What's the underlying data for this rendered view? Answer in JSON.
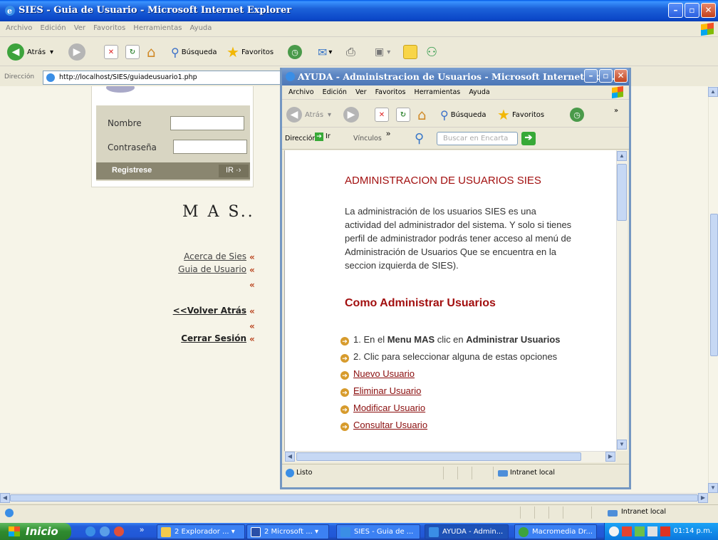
{
  "main_window": {
    "title": "SIES - Guia de Usuario - Microsoft Internet Explorer",
    "menu": [
      "Archivo",
      "Edición",
      "Ver",
      "Favoritos",
      "Herramientas",
      "Ayuda"
    ],
    "toolbar": {
      "back": "Atrás",
      "search": "Búsqueda",
      "favorites": "Favoritos"
    },
    "address_label": "Dirección",
    "address_url": "http://localhost/SIES/guiadeusuario1.php",
    "status_zone": "Intranet local"
  },
  "page": {
    "login": {
      "nombre_label": "Nombre",
      "pass_label": "Contraseña",
      "register": "Registrese",
      "go": "IR"
    },
    "mas_title": "M A S..",
    "links": {
      "acerca": "Acerca de Sies",
      "guia": "Guia de Usuario",
      "volver": "<<Volver Atrás",
      "cerrar": "Cerrar Sesión"
    },
    "raquo": "«"
  },
  "popup": {
    "title": "AYUDA - Administracion de Usuarios - Microsoft Internet Expl...",
    "menu": [
      "Archivo",
      "Edición",
      "Ver",
      "Favoritos",
      "Herramientas",
      "Ayuda"
    ],
    "toolbar": {
      "back": "Atrás",
      "search": "Búsqueda",
      "favorites": "Favoritos"
    },
    "address_label": "Dirección",
    "go": "Ir",
    "links_label": "Vínculos",
    "search_placeholder": "Buscar en Encarta",
    "heading": "ADMINISTRACION DE USUARIOS SIES",
    "paragraph": "La administración de los usuarios SIES es una actividad del administrador del sistema. Y solo si tienes perfil de administrador podrás tener acceso al menú de Administración de Usuarios Que se encuentra en la seccion izquierda de SIES).",
    "subheading": "Como Administrar Usuarios",
    "step1_pre": "1. En el",
    "step1_menu": "Menu MAS",
    "step1_mid": "clic en",
    "step1_action": "Administrar Usuarios",
    "step2": "2. Clic para seleccionar alguna de estas opciones",
    "options": [
      "Nuevo Usuario",
      "Eliminar Usuario",
      "Modificar Usuario",
      "Consultar Usuario"
    ],
    "status_ready": "Listo",
    "status_zone": "Intranet local"
  },
  "taskbar": {
    "start": "Inicio",
    "buttons": [
      "2 Explorador ...",
      "2 Microsoft ...",
      "SIES - Guia de ...",
      "AYUDA - Admin...",
      "Macromedia Dr..."
    ],
    "time": "01:14 p.m."
  }
}
